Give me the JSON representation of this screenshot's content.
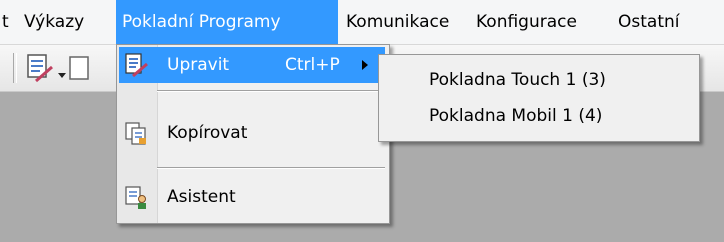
{
  "menubar": {
    "items": [
      {
        "label": "t"
      },
      {
        "label": "Výkazy"
      },
      {
        "label": "Pokladní Programy"
      },
      {
        "label": "Komunikace"
      },
      {
        "label": "Konfigurace"
      },
      {
        "label": "Ostatní"
      }
    ]
  },
  "menu": {
    "items": [
      {
        "label": "Upravit",
        "shortcut": "Ctrl+P",
        "icon": "edit-document-icon"
      },
      {
        "label": "Kopírovat",
        "icon": "copy-document-icon"
      },
      {
        "label": "Asistent",
        "icon": "wizard-user-icon"
      }
    ]
  },
  "submenu": {
    "items": [
      {
        "label": "Pokladna Touch 1 (3)"
      },
      {
        "label": "Pokladna Mobil 1 (4)"
      }
    ]
  },
  "colors": {
    "highlight": "#3399ff",
    "menu_bg": "#f0f0f0",
    "workspace": "#ababab"
  }
}
